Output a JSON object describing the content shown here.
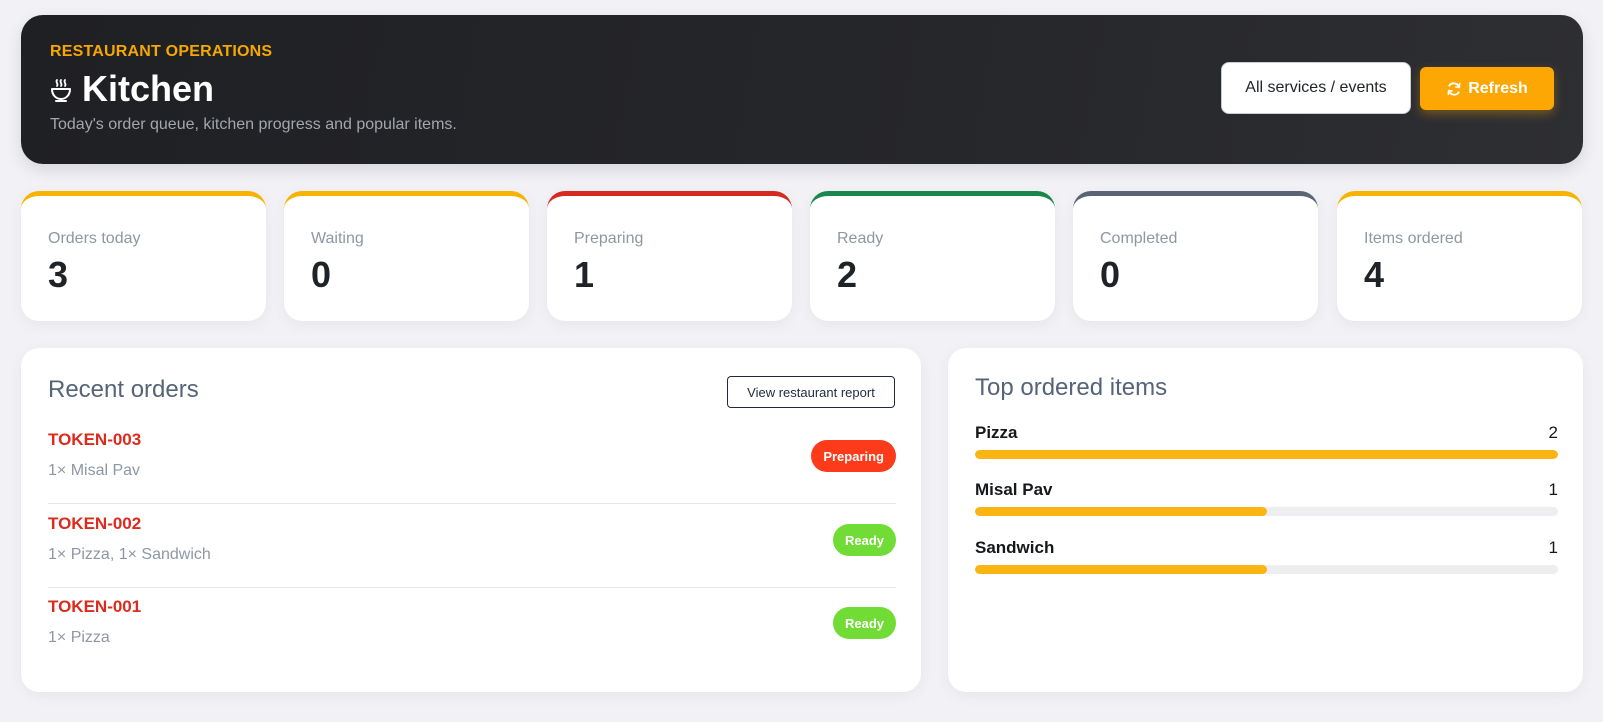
{
  "header": {
    "eyebrow": "RESTAURANT OPERATIONS",
    "title": "Kitchen",
    "subtitle": "Today's order queue, kitchen progress and popular items.",
    "service_select": "All services / events",
    "refresh_label": "Refresh",
    "icon": "bowl-steam-icon"
  },
  "stats": [
    {
      "label": "Orders today",
      "value": "3",
      "accent": "#f6b300"
    },
    {
      "label": "Waiting",
      "value": "0",
      "accent": "#f6b300"
    },
    {
      "label": "Preparing",
      "value": "1",
      "accent": "#d42a1f"
    },
    {
      "label": "Ready",
      "value": "2",
      "accent": "#19874c"
    },
    {
      "label": "Completed",
      "value": "0",
      "accent": "#596474"
    },
    {
      "label": "Items ordered",
      "value": "4",
      "accent": "#f6b300"
    }
  ],
  "recent_orders": {
    "title": "Recent orders",
    "report_button": "View restaurant report",
    "orders": [
      {
        "token": "TOKEN-003",
        "items": "1× Misal Pav",
        "status": "Preparing",
        "status_color": "#fb3b1a"
      },
      {
        "token": "TOKEN-002",
        "items": "1× Pizza, 1× Sandwich",
        "status": "Ready",
        "status_color": "#72dc37"
      },
      {
        "token": "TOKEN-001",
        "items": "1× Pizza",
        "status": "Ready",
        "status_color": "#72dc37"
      }
    ]
  },
  "top_items": {
    "title": "Top ordered items",
    "items": [
      {
        "name": "Pizza",
        "count": "2",
        "share": 1.0
      },
      {
        "name": "Misal Pav",
        "count": "1",
        "share": 0.5
      },
      {
        "name": "Sandwich",
        "count": "1",
        "share": 0.5
      }
    ],
    "bar_color": "#fbb512"
  }
}
